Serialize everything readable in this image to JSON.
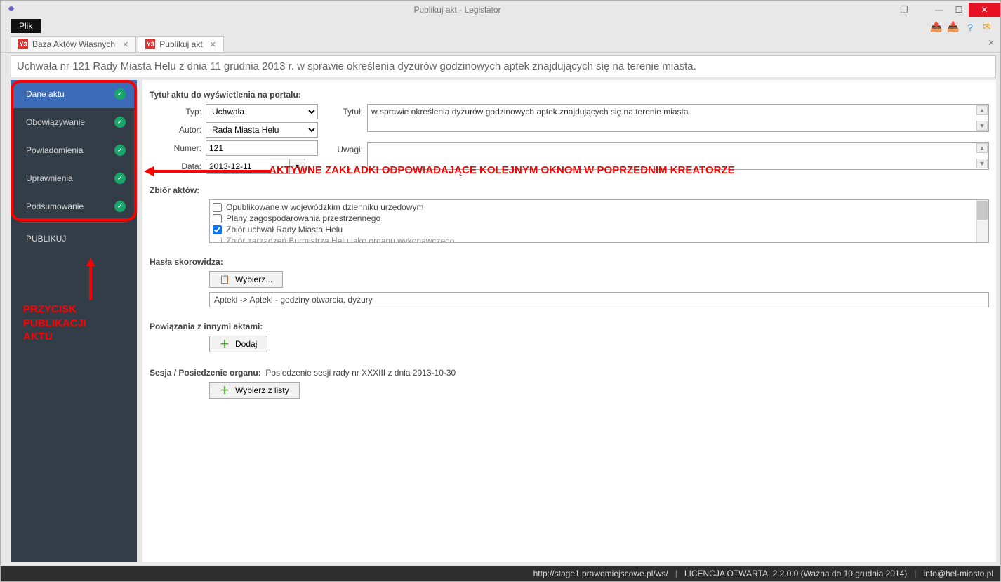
{
  "titlebar": {
    "title": "Publikuj akt - Legislator"
  },
  "menu": {
    "file": "Plik"
  },
  "tabs": {
    "baza": "Baza Aktów Własnych",
    "publikuj": "Publikuj akt"
  },
  "doc_title": "Uchwała nr 121 Rady Miasta Helu z dnia 11 grudnia 2013 r. w sprawie określenia dyżurów godzinowych aptek znajdujących się na terenie miasta.",
  "sidebar": {
    "items": [
      {
        "label": "Dane aktu"
      },
      {
        "label": "Obowiązywanie"
      },
      {
        "label": "Powiadomienia"
      },
      {
        "label": "Uprawnienia"
      },
      {
        "label": "Podsumowanie"
      }
    ],
    "publish": "PUBLIKUJ"
  },
  "annotations": {
    "main": "AKTYWNE ZAKŁADKI ODPOWIADAJĄCE KOLEJNYM OKNOM W POPRZEDNIM KREATORZE",
    "side1": "PRZYCISK",
    "side2": "PUBLIKACJI",
    "side3": "AKTU"
  },
  "form": {
    "header_title": "Tytuł aktu do wyświetlenia na portalu:",
    "typ_label": "Typ:",
    "typ_value": "Uchwała",
    "autor_label": "Autor:",
    "autor_value": "Rada Miasta Helu",
    "numer_label": "Numer:",
    "numer_value": "121",
    "data_label": "Data:",
    "data_value": "2013-12-11",
    "tytul_label": "Tytuł:",
    "tytul_value": "w sprawie określenia dyżurów godzinowych aptek znajdujących się na terenie miasta",
    "uwagi_label": "Uwagi:",
    "uwagi_value": ""
  },
  "zbior": {
    "label": "Zbiór aktów:",
    "items": [
      {
        "checked": false,
        "label": "Opublikowane w wojewódzkim dzienniku urzędowym"
      },
      {
        "checked": false,
        "label": "Plany zagospodarowania przestrzennego"
      },
      {
        "checked": true,
        "label": "Zbiór uchwał Rady Miasta Helu"
      },
      {
        "checked": false,
        "label": "Zbiór zarządzeń Burmistrza Helu jako organu wykonawczego"
      }
    ]
  },
  "hasla": {
    "label": "Hasła skorowidza:",
    "button": "Wybierz...",
    "value": "Apteki -> Apteki - godziny otwarcia, dyżury"
  },
  "powiazania": {
    "label": "Powiązania z innymi aktami:",
    "button": "Dodaj"
  },
  "sesja": {
    "label": "Sesja / Posiedzenie organu:",
    "value": "Posiedzenie sesji rady nr XXXIII z dnia 2013-10-30",
    "button": "Wybierz z listy"
  },
  "status": {
    "url": "http://stage1.prawomiejscowe.pl/ws/",
    "lic": "LICENCJA OTWARTA, 2.2.0.0 (Ważna do 10 grudnia 2014)",
    "email": "info@hel-miasto.pl"
  }
}
